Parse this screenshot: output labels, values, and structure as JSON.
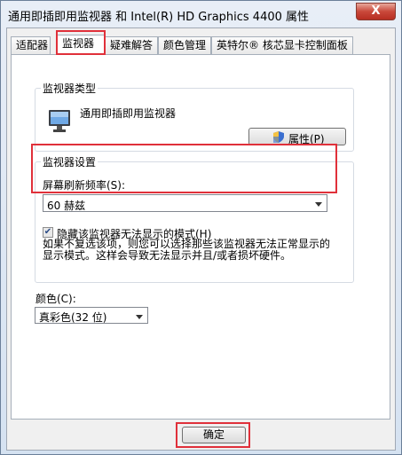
{
  "window": {
    "title": "通用即插即用监视器 和 Intel(R) HD Graphics 4400 属性",
    "close_symbol": "X"
  },
  "tabs": [
    {
      "label": "适配器"
    },
    {
      "label": "监视器"
    },
    {
      "label": "疑难解答"
    },
    {
      "label": "颜色管理"
    },
    {
      "label": "英特尔® 核芯显卡控制面板"
    }
  ],
  "monitor_type": {
    "group_title": "监视器类型",
    "monitor_name": "通用即插即用监视器",
    "properties_button": "属性(P)"
  },
  "monitor_settings": {
    "group_title": "监视器设置",
    "refresh_label": "屏幕刷新频率(S):",
    "refresh_value": "60 赫兹",
    "hide_modes_label": "隐藏该监视器无法显示的模式(H)",
    "hide_modes_checked": true,
    "help_line1": "如果不复选该项，则您可以选择那些该监视器无法正常显示的",
    "help_line2": "显示模式。这样会导致无法显示并且/或者损坏硬件。"
  },
  "colors": {
    "label": "颜色(C):",
    "value": "真彩色(32 位)"
  },
  "footer": {
    "ok_button": "确定"
  },
  "accent": {
    "highlight": "#e0303a"
  }
}
